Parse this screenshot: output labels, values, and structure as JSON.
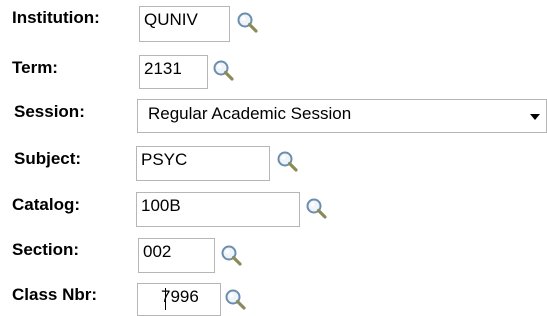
{
  "form": {
    "institution": {
      "label": "Institution:",
      "value": "QUNIV"
    },
    "term": {
      "label": "Term:",
      "value": "2131"
    },
    "session": {
      "label": "Session:",
      "value": "Regular Academic Session"
    },
    "subject": {
      "label": "Subject:",
      "value": "PSYC"
    },
    "catalog": {
      "label": "Catalog:",
      "value": "100B"
    },
    "section": {
      "label": "Section:",
      "value": "002"
    },
    "class_nbr": {
      "label": "Class Nbr:",
      "value": "7996"
    }
  },
  "icons": {
    "lookup": "magnifying-glass-icon",
    "dropdown": "chevron-down-icon"
  },
  "colors": {
    "field_border": "#b6b6b6",
    "lookup_lens": "#6d8dad",
    "lookup_handle": "#8a8a5a"
  }
}
